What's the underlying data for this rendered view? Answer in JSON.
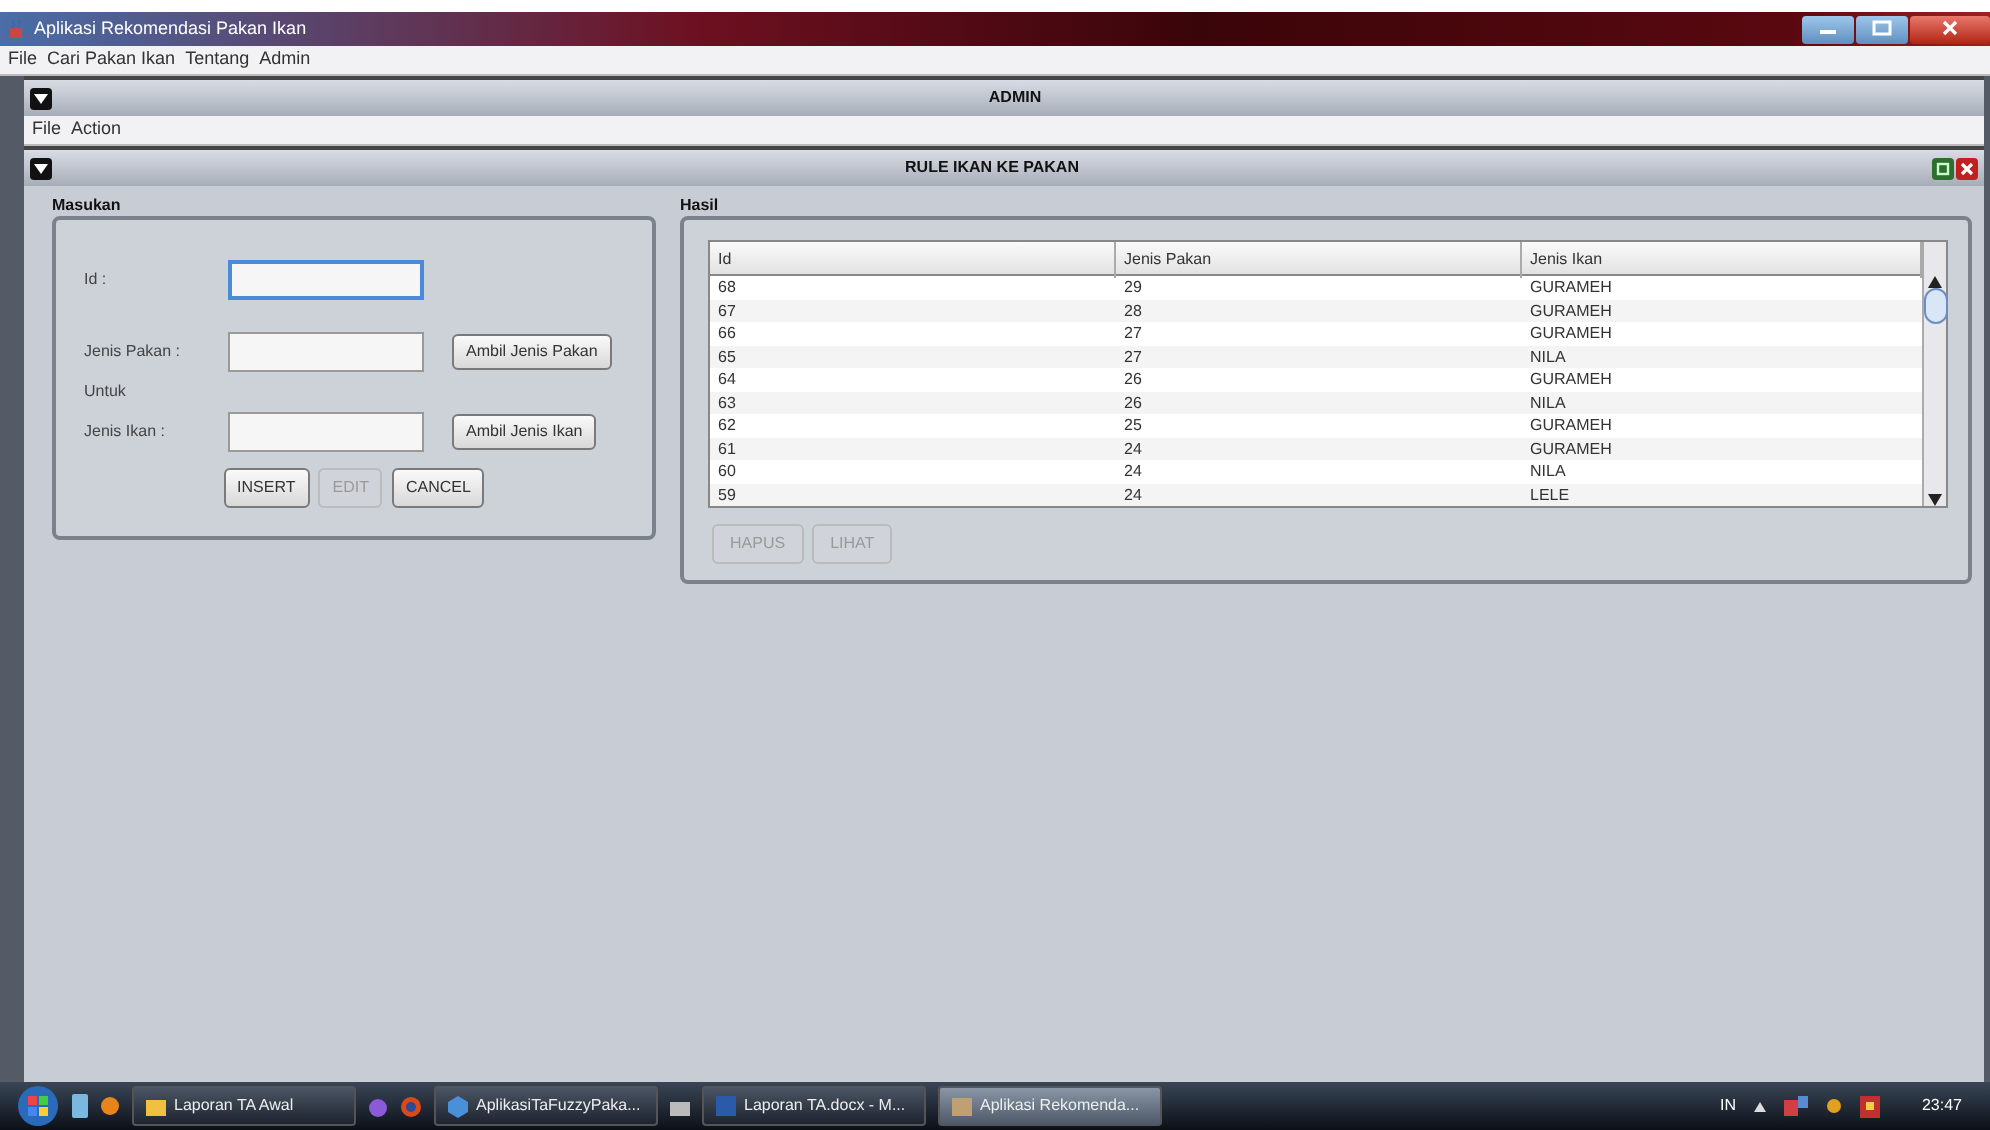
{
  "window": {
    "title": "Aplikasi Rekomendasi Pakan Ikan"
  },
  "menu": [
    "File",
    "Cari Pakan Ikan",
    "Tentang",
    "Admin"
  ],
  "admin_frame": {
    "title": "ADMIN",
    "menu": [
      "File",
      "Action"
    ]
  },
  "rule_frame": {
    "title": "RULE IKAN KE PAKAN"
  },
  "masukan": {
    "title": "Masukan",
    "fields": [
      {
        "label": "Id :",
        "focused": true
      },
      {
        "label": "Jenis Pakan :",
        "focused": false,
        "button": "Ambil Jenis Pakan",
        "note": "Untuk"
      },
      {
        "label": "Jenis Ikan :",
        "focused": false,
        "button": "Ambil Jenis Ikan"
      }
    ],
    "buttons": [
      {
        "label": "INSERT",
        "disabled": false
      },
      {
        "label": "EDIT",
        "disabled": true
      },
      {
        "label": "CANCEL",
        "disabled": false
      }
    ]
  },
  "hasil": {
    "title": "Hasil",
    "table": {
      "columns": [
        "Id",
        "Jenis Pakan",
        "Jenis Ikan"
      ],
      "rows": [
        [
          "68",
          "29",
          "GURAMEH"
        ],
        [
          "67",
          "28",
          "GURAMEH"
        ],
        [
          "66",
          "27",
          "GURAMEH"
        ],
        [
          "65",
          "27",
          "NILA"
        ],
        [
          "64",
          "26",
          "GURAMEH"
        ],
        [
          "63",
          "26",
          "NILA"
        ],
        [
          "62",
          "25",
          "GURAMEH"
        ],
        [
          "61",
          "24",
          "GURAMEH"
        ],
        [
          "60",
          "24",
          "NILA"
        ],
        [
          "59",
          "24",
          "LELE"
        ]
      ]
    },
    "buttons": [
      {
        "label": "HAPUS",
        "disabled": true
      },
      {
        "label": "LIHAT",
        "disabled": true
      }
    ]
  },
  "taskbar": {
    "items": [
      {
        "label": "Laporan TA Awal",
        "kind": "folder",
        "selected": false
      },
      {
        "label": "AplikasiTaFuzzyPaka...",
        "kind": "app",
        "selected": false
      },
      {
        "label": "Laporan TA.docx - M...",
        "kind": "word",
        "selected": false
      },
      {
        "label": "Aplikasi Rekomenda...",
        "kind": "java",
        "selected": true
      }
    ],
    "language": "IN",
    "clock": "23:47"
  }
}
